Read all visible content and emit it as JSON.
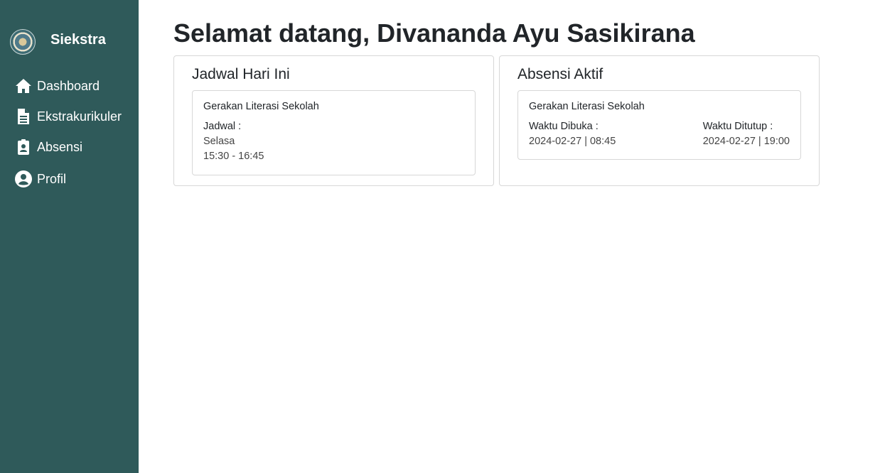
{
  "sidebar": {
    "brand": "Siekstra",
    "items": [
      {
        "label": "Dashboard",
        "icon": "home-icon"
      },
      {
        "label": "Ekstrakurikuler",
        "icon": "document-icon"
      },
      {
        "label": "Absensi",
        "icon": "clipboard-user-icon"
      },
      {
        "label": "Profil",
        "icon": "user-circle-icon"
      }
    ],
    "background": "#2f5a5a"
  },
  "main": {
    "title": "Selamat datang, Divananda Ayu Sasikirana"
  },
  "jadwal": {
    "title": "Jadwal Hari Ini",
    "activity": "Gerakan Literasi Sekolah",
    "label": "Jadwal :",
    "day": "Selasa",
    "time": "15:30 - 16:45"
  },
  "absensi": {
    "title": "Absensi Aktif",
    "activity": "Gerakan Literasi Sekolah",
    "open_label": "Waktu Dibuka :",
    "open_value": "2024-02-27 | 08:45",
    "close_label": "Waktu Ditutup :",
    "close_value": "2024-02-27 | 19:00"
  }
}
